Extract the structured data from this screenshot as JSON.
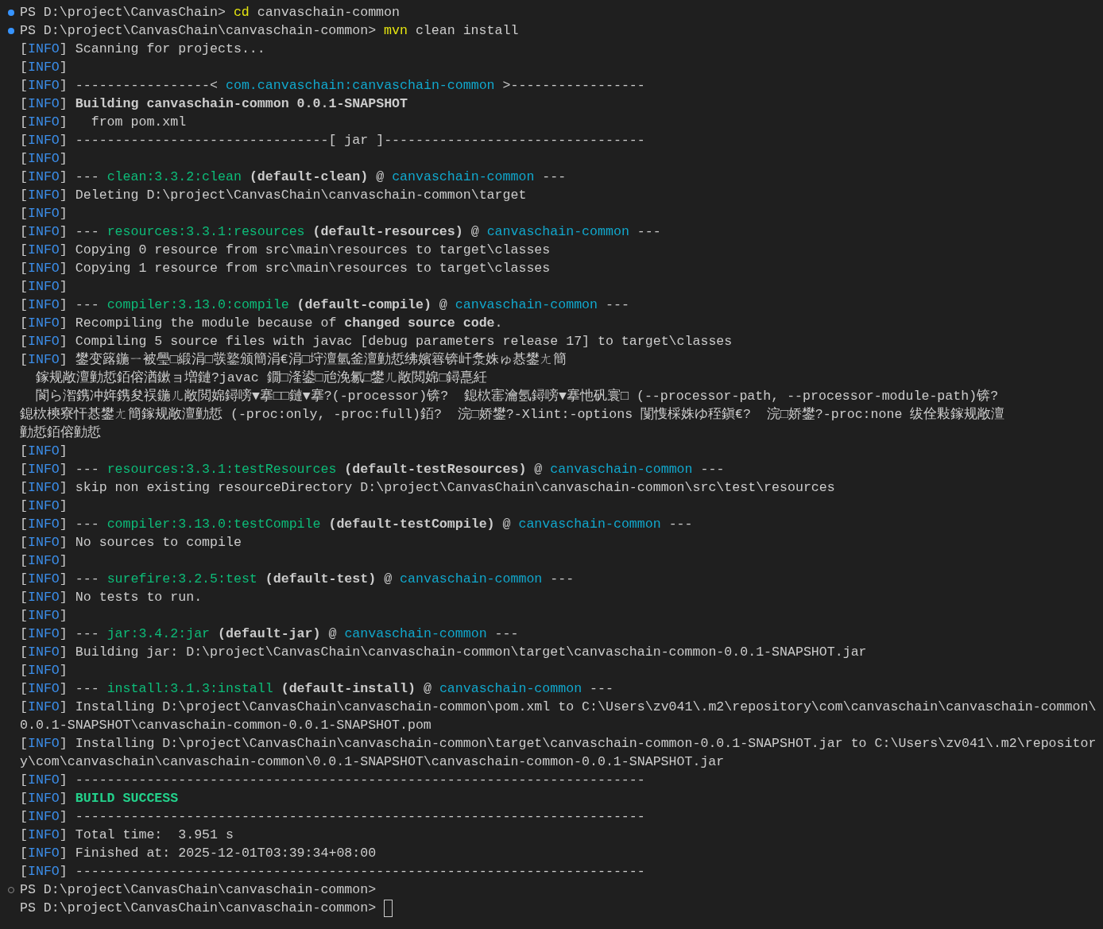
{
  "terminal": {
    "lines": [
      {
        "kind": "finished",
        "segments": [
          {
            "kind": "prompt",
            "t": "PS D:\\project\\CanvasChain> "
          },
          {
            "kind": "command",
            "t": "cd"
          },
          {
            "kind": "text",
            "t": " canvaschain-common"
          }
        ]
      },
      {
        "kind": "finished",
        "segments": [
          {
            "kind": "prompt",
            "t": "PS D:\\project\\CanvasChain\\canvaschain-common> "
          },
          {
            "kind": "command",
            "t": "mvn"
          },
          {
            "kind": "text",
            "t": " clean install"
          }
        ]
      },
      {
        "tag": "[INFO]",
        "segments": [
          {
            "kind": "text",
            "t": "Scanning for projects..."
          }
        ]
      },
      {
        "tag": "[INFO]"
      },
      {
        "tag": "[INFO]",
        "segments": [
          {
            "kind": "text",
            "t": "-----------------< "
          },
          {
            "kind": "artifact",
            "t": "com.canvaschain:canvaschain-common"
          },
          {
            "kind": "text",
            "t": " >-----------------"
          }
        ]
      },
      {
        "tag": "[INFO]",
        "segments": [
          {
            "kind": "bold",
            "t": "Building canvaschain-common 0.0.1-SNAPSHOT"
          }
        ]
      },
      {
        "tag": "[INFO]",
        "segments": [
          {
            "kind": "text",
            "t": "  from pom.xml"
          }
        ]
      },
      {
        "tag": "[INFO]",
        "segments": [
          {
            "kind": "text",
            "t": "--------------------------------[ jar ]---------------------------------"
          }
        ]
      },
      {
        "tag": "[INFO]"
      },
      {
        "tag": "[INFO]",
        "segments": [
          {
            "kind": "text",
            "t": "--- "
          },
          {
            "kind": "plugin",
            "t": "clean:3.3.2:clean"
          },
          {
            "kind": "bold",
            "t": " (default-clean)"
          },
          {
            "kind": "text",
            "t": " @ "
          },
          {
            "kind": "artifact",
            "t": "canvaschain-common"
          },
          {
            "kind": "text",
            "t": " ---"
          }
        ]
      },
      {
        "tag": "[INFO]",
        "segments": [
          {
            "kind": "text",
            "t": "Deleting D:\\project\\CanvasChain\\canvaschain-common\\target"
          }
        ]
      },
      {
        "tag": "[INFO]"
      },
      {
        "tag": "[INFO]",
        "segments": [
          {
            "kind": "text",
            "t": "--- "
          },
          {
            "kind": "plugin",
            "t": "resources:3.3.1:resources"
          },
          {
            "kind": "bold",
            "t": " (default-resources)"
          },
          {
            "kind": "text",
            "t": " @ "
          },
          {
            "kind": "artifact",
            "t": "canvaschain-common"
          },
          {
            "kind": "text",
            "t": " ---"
          }
        ]
      },
      {
        "tag": "[INFO]",
        "segments": [
          {
            "kind": "text",
            "t": "Copying 0 resource from src\\main\\resources to target\\classes"
          }
        ]
      },
      {
        "tag": "[INFO]",
        "segments": [
          {
            "kind": "text",
            "t": "Copying 1 resource from src\\main\\resources to target\\classes"
          }
        ]
      },
      {
        "tag": "[INFO]"
      },
      {
        "tag": "[INFO]",
        "segments": [
          {
            "kind": "text",
            "t": "--- "
          },
          {
            "kind": "plugin",
            "t": "compiler:3.13.0:compile"
          },
          {
            "kind": "bold",
            "t": " (default-compile)"
          },
          {
            "kind": "text",
            "t": " @ "
          },
          {
            "kind": "artifact",
            "t": "canvaschain-common"
          },
          {
            "kind": "text",
            "t": " ---"
          }
        ]
      },
      {
        "tag": "[INFO]",
        "segments": [
          {
            "kind": "text",
            "t": "Recompiling the module because of **changed source code**."
          }
        ]
      },
      {
        "tag": "[INFO]",
        "segments": [
          {
            "kind": "text",
            "t": "Compiling 5 source files with javac [debug parameters release 17] to target\\classes"
          }
        ]
      },
      {
        "tag": "[INFO]",
        "segments": [
          {
            "kind": "text",
            "t": "鐢变簬鍦ㄧ被璺□緞涓□彂鐜颁簡涓€涓□垨澶氫釜澶勭悊绋嬪簭锛屽洜姝ゅ惎鐢ㄤ簡"
          }
        ]
      },
      {
        "segments": [
          {
            "kind": "text",
            "t": "  鎵规敞澶勭悊銆傛湭鏉ョ増鏈?javac 鐗□湰鍙□兘浼氱□鐢ㄦ敞閲婂□鐞嗭紝"
          }
        ]
      },
      {
        "segments": [
          {
            "kind": "text",
            "t": "  閬ら潪鎸冲姩鎸夋祦鍦ㄦ敞閲婂鐞嗙▼搴□□鏈▼搴?(-processor)锛?  鎴栨寚瀹氬鐞嗙▼搴忚矾寰□ (--processor-path, --processor-module-path)锛?"
          }
        ]
      },
      {
        "segments": [
          {
            "kind": "text",
            "t": "鎴栨樉寮忓惎鐢ㄤ簡鎵规敞澶勭悊 (-proc:only, -proc:full)銆?  浣□娇鐢?-Xlint:-options 闅愯棌姝ゆ秷鎭€?  浣□娇鐢?-proc:none 绂佺敤鎵规敞澶"
          }
        ]
      },
      {
        "segments": [
          {
            "kind": "text",
            "t": "勭悊銆傛勭悊"
          }
        ]
      },
      {
        "tag": "[INFO]"
      },
      {
        "tag": "[INFO]",
        "segments": [
          {
            "kind": "text",
            "t": "--- "
          },
          {
            "kind": "plugin",
            "t": "resources:3.3.1:testResources"
          },
          {
            "kind": "bold",
            "t": " (default-testResources)"
          },
          {
            "kind": "text",
            "t": " @ "
          },
          {
            "kind": "artifact",
            "t": "canvaschain-common"
          },
          {
            "kind": "text",
            "t": " ---"
          }
        ]
      },
      {
        "tag": "[INFO]",
        "segments": [
          {
            "kind": "text",
            "t": "skip non existing resourceDirectory D:\\project\\CanvasChain\\canvaschain-common\\src\\test\\resources"
          }
        ]
      },
      {
        "tag": "[INFO]"
      },
      {
        "tag": "[INFO]",
        "segments": [
          {
            "kind": "text",
            "t": "--- "
          },
          {
            "kind": "plugin",
            "t": "compiler:3.13.0:testCompile"
          },
          {
            "kind": "bold",
            "t": " (default-testCompile)"
          },
          {
            "kind": "text",
            "t": " @ "
          },
          {
            "kind": "artifact",
            "t": "canvaschain-common"
          },
          {
            "kind": "text",
            "t": " ---"
          }
        ]
      },
      {
        "tag": "[INFO]",
        "segments": [
          {
            "kind": "text",
            "t": "No sources to compile"
          }
        ]
      },
      {
        "tag": "[INFO]"
      },
      {
        "tag": "[INFO]",
        "segments": [
          {
            "kind": "text",
            "t": "--- "
          },
          {
            "kind": "plugin",
            "t": "surefire:3.2.5:test"
          },
          {
            "kind": "bold",
            "t": " (default-test)"
          },
          {
            "kind": "text",
            "t": " @ "
          },
          {
            "kind": "artifact",
            "t": "canvaschain-common"
          },
          {
            "kind": "text",
            "t": " ---"
          }
        ]
      },
      {
        "tag": "[INFO]",
        "segments": [
          {
            "kind": "text",
            "t": "No tests to run."
          }
        ]
      },
      {
        "tag": "[INFO]"
      },
      {
        "tag": "[INFO]",
        "segments": [
          {
            "kind": "text",
            "t": "--- "
          },
          {
            "kind": "plugin",
            "t": "jar:3.4.2:jar"
          },
          {
            "kind": "bold",
            "t": " (default-jar)"
          },
          {
            "kind": "text",
            "t": " @ "
          },
          {
            "kind": "artifact",
            "t": "canvaschain-common"
          },
          {
            "kind": "text",
            "t": " ---"
          }
        ]
      },
      {
        "tag": "[INFO]",
        "segments": [
          {
            "kind": "text",
            "t": "Building jar: D:\\project\\CanvasChain\\canvaschain-common\\target\\canvaschain-common-0.0.1-SNAPSHOT.jar"
          }
        ]
      },
      {
        "tag": "[INFO]"
      },
      {
        "tag": "[INFO]",
        "segments": [
          {
            "kind": "text",
            "t": "--- "
          },
          {
            "kind": "plugin",
            "t": "install:3.1.3:install"
          },
          {
            "kind": "bold",
            "t": " (default-install)"
          },
          {
            "kind": "text",
            "t": " @ "
          },
          {
            "kind": "artifact",
            "t": "canvaschain-common"
          },
          {
            "kind": "text",
            "t": " ---"
          }
        ]
      },
      {
        "tag": "[INFO]",
        "segments": [
          {
            "kind": "text",
            "t": "Installing D:\\project\\CanvasChain\\canvaschain-common\\pom.xml to C:\\Users\\zv041\\.m2\\repository\\com\\canvaschain\\canvaschain-common\\"
          }
        ]
      },
      {
        "segments": [
          {
            "kind": "text",
            "t": "0.0.1-SNAPSHOT\\canvaschain-common-0.0.1-SNAPSHOT.pom"
          }
        ]
      },
      {
        "tag": "[INFO]",
        "segments": [
          {
            "kind": "text",
            "t": "Installing D:\\project\\CanvasChain\\canvaschain-common\\target\\canvaschain-common-0.0.1-SNAPSHOT.jar to C:\\Users\\zv041\\.m2\\repositor"
          }
        ]
      },
      {
        "segments": [
          {
            "kind": "text",
            "t": "y\\com\\canvaschain\\canvaschain-common\\0.0.1-SNAPSHOT\\canvaschain-common-0.0.1-SNAPSHOT.jar"
          }
        ]
      },
      {
        "tag": "[INFO]",
        "segments": [
          {
            "kind": "text",
            "t": "------------------------------------------------------------------------"
          }
        ]
      },
      {
        "tag": "[INFO]",
        "segments": [
          {
            "kind": "success",
            "t": "BUILD SUCCESS"
          }
        ]
      },
      {
        "tag": "[INFO]",
        "segments": [
          {
            "kind": "text",
            "t": "------------------------------------------------------------------------"
          }
        ]
      },
      {
        "tag": "[INFO]",
        "segments": [
          {
            "kind": "text",
            "t": "Total time:  3.951 s"
          }
        ]
      },
      {
        "tag": "[INFO]",
        "segments": [
          {
            "kind": "text",
            "t": "Finished at: 2025-12-01T03:39:34+08:00"
          }
        ]
      },
      {
        "tag": "[INFO]",
        "segments": [
          {
            "kind": "text",
            "t": "------------------------------------------------------------------------"
          }
        ]
      },
      {
        "kind": "idle",
        "segments": [
          {
            "kind": "prompt",
            "t": "PS D:\\project\\CanvasChain\\canvaschain-common>"
          }
        ]
      },
      {
        "segments": [
          {
            "kind": "prompt",
            "t": "PS D:\\project\\CanvasChain\\canvaschain-common> "
          }
        ],
        "cursor": true
      }
    ]
  }
}
